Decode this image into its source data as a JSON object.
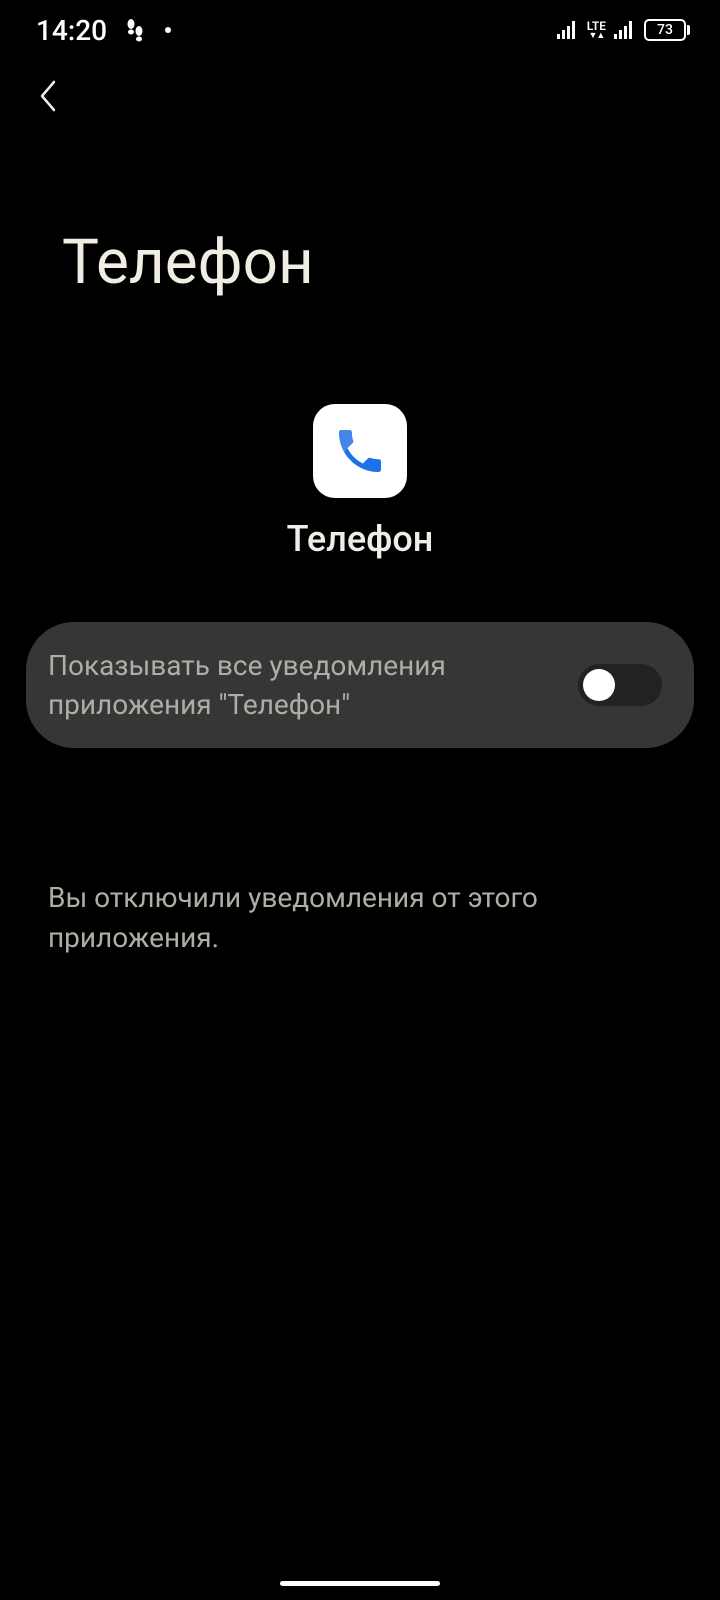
{
  "status_bar": {
    "time": "14:20",
    "battery": "73",
    "network": "LTE"
  },
  "page": {
    "title": "Телефон"
  },
  "app": {
    "name": "Телефон"
  },
  "setting": {
    "label": "Показывать все уведомления приложения \"Телефон\"",
    "enabled": false
  },
  "message": {
    "info": "Вы отключили уведомления от этого приложения."
  }
}
